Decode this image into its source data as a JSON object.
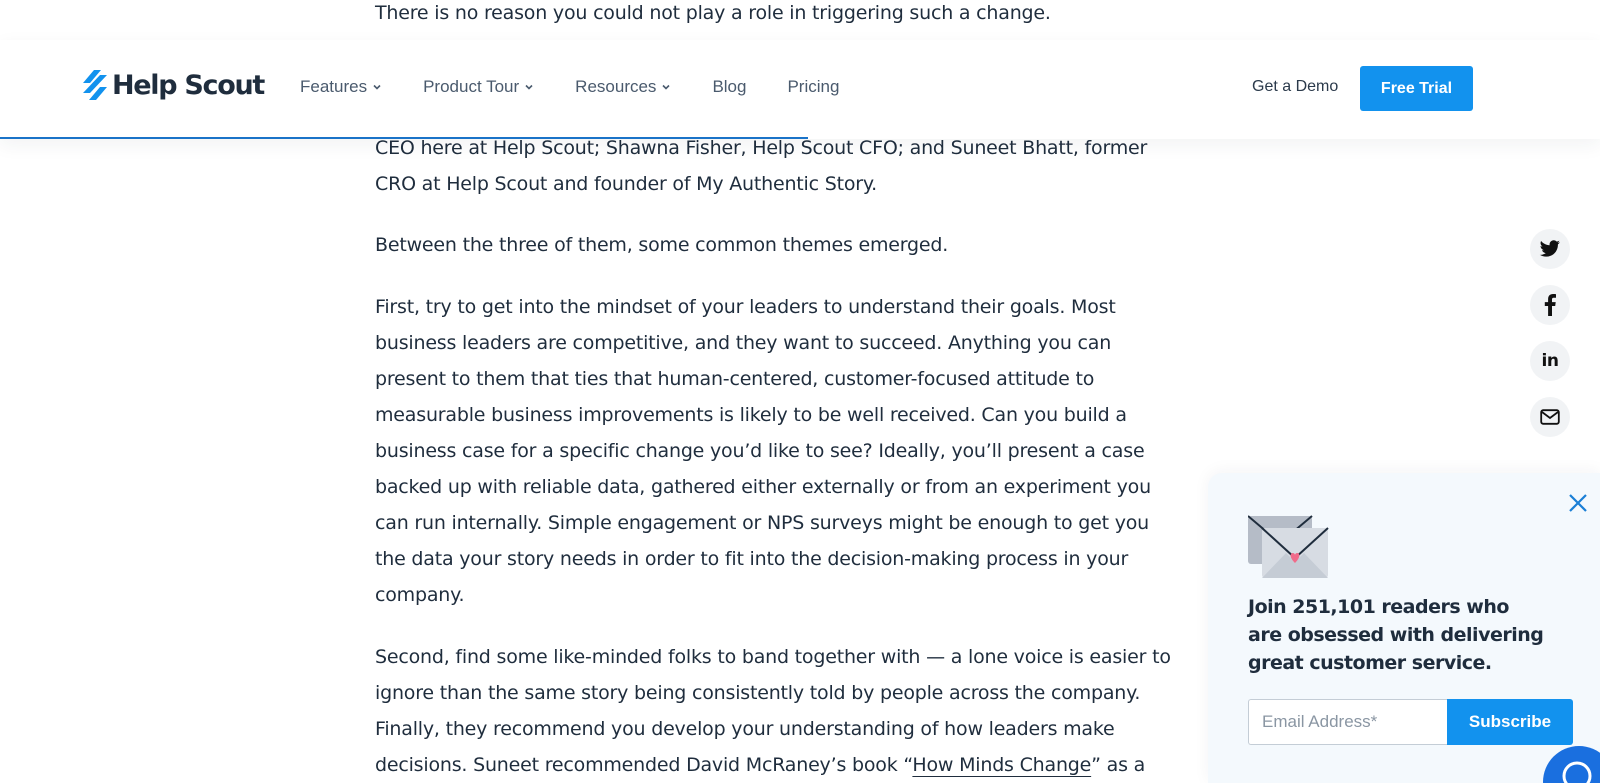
{
  "article": {
    "p_top": "There is no reason you could not play a role in triggering such a change.",
    "p_ceo": "CEO here at Help Scout; Shawna Fisher, Help Scout CFO; and Suneet Bhatt, former CRO at Help Scout and founder of My Authentic Story.",
    "p_between": "Between the three of them, some common themes emerged.",
    "p_first": "First, try to get into the mindset of your leaders to understand their goals. Most business leaders are competitive, and they want to succeed. Anything you can present to them that ties that human-centered, customer-focused attitude to measurable business improvements is likely to be well received. Can you build a business case for a specific change you’d like to see? Ideally, you’ll present a case backed up with reliable data, gathered either externally or from an experiment you can run internally. Simple engagement or NPS surveys might be enough to get you the data your story needs in order to fit into the decision-making process in your company.",
    "p_second_before": "Second, find some like-minded folks to band together with — a lone voice is easier to ignore than the same story being consistently told by people across the company. Finally, they recommend you develop your understanding of how leaders make decisions. Suneet recommended David McRaney’s book “",
    "p_second_link": "How Minds Change",
    "p_second_after": "” as a"
  },
  "header": {
    "logo_text": "Help Scout",
    "nav": [
      {
        "label": "Features",
        "icon": "chevron-down-icon"
      },
      {
        "label": "Product Tour",
        "icon": "chevron-down-icon"
      },
      {
        "label": "Resources",
        "icon": "chevron-down-icon"
      },
      {
        "label": "Blog"
      },
      {
        "label": "Pricing"
      }
    ],
    "get_demo": "Get a Demo",
    "free_trial": "Free Trial",
    "read_progress": 0.505
  },
  "share": [
    "twitter-icon",
    "facebook-icon",
    "linkedin-icon",
    "mail-icon"
  ],
  "share_linkedin_text": "in",
  "newsletter": {
    "heading": "Join 251,101 readers who are obsessed with delivering great customer service.",
    "email_placeholder": "Email Address*",
    "subscribe": "Subscribe"
  },
  "colors": {
    "brand_blue": "#1292ee",
    "progress": "#1a73c8",
    "text": "#1f2d3d"
  }
}
